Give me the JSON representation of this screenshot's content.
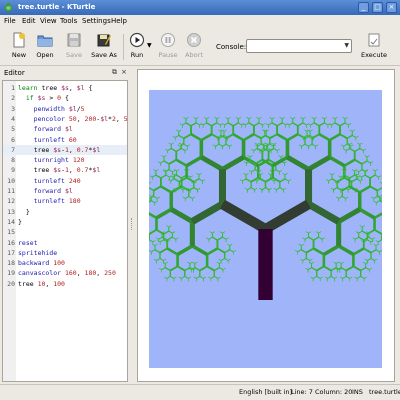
{
  "window": {
    "title": "tree.turtle - KTurtle",
    "buttons": {
      "minimize": "_",
      "maximize": "□",
      "close": "×"
    }
  },
  "menu": [
    "File",
    "Edit",
    "View",
    "Tools",
    "Settings",
    "Help"
  ],
  "toolbar": {
    "new_label": "New",
    "open_label": "Open",
    "save_label": "Save",
    "save_as_label": "Save As",
    "run_label": "Run",
    "pause_label": "Pause",
    "abort_label": "Abort",
    "console_label": "Console:",
    "console_value": "",
    "execute_label": "Execute"
  },
  "editor": {
    "title": "Editor",
    "current_line": 7,
    "lines": [
      {
        "n": "1",
        "segs": [
          [
            "kw",
            "learn"
          ],
          [
            "plain",
            " tree "
          ],
          [
            "var",
            "$s"
          ],
          [
            "plain",
            ", "
          ],
          [
            "var",
            "$l"
          ],
          [
            "plain",
            " {"
          ]
        ]
      },
      {
        "n": "2",
        "segs": [
          [
            "plain",
            "  "
          ],
          [
            "kw",
            "if"
          ],
          [
            "plain",
            " "
          ],
          [
            "var",
            "$s"
          ],
          [
            "plain",
            " > "
          ],
          [
            "num",
            "0"
          ],
          [
            "plain",
            " {"
          ]
        ]
      },
      {
        "n": "3",
        "segs": [
          [
            "plain",
            "    "
          ],
          [
            "cmd",
            "penwidth"
          ],
          [
            "plain",
            " "
          ],
          [
            "var",
            "$l"
          ],
          [
            "plain",
            "/"
          ],
          [
            "num",
            "5"
          ]
        ]
      },
      {
        "n": "4",
        "segs": [
          [
            "plain",
            "    "
          ],
          [
            "cmd",
            "pencolor"
          ],
          [
            "plain",
            " "
          ],
          [
            "num",
            "50"
          ],
          [
            "plain",
            ", "
          ],
          [
            "num",
            "200"
          ],
          [
            "plain",
            "-"
          ],
          [
            "var",
            "$l"
          ],
          [
            "plain",
            "*"
          ],
          [
            "num",
            "2"
          ],
          [
            "plain",
            ", "
          ],
          [
            "num",
            "50"
          ]
        ]
      },
      {
        "n": "5",
        "segs": [
          [
            "plain",
            "    "
          ],
          [
            "cmd",
            "forward"
          ],
          [
            "plain",
            " "
          ],
          [
            "var",
            "$l"
          ]
        ]
      },
      {
        "n": "6",
        "segs": [
          [
            "plain",
            "    "
          ],
          [
            "cmd",
            "turnleft"
          ],
          [
            "plain",
            " "
          ],
          [
            "num",
            "60"
          ]
        ]
      },
      {
        "n": "7",
        "segs": [
          [
            "plain",
            "    "
          ],
          [
            "plain",
            "tree "
          ],
          [
            "var",
            "$s"
          ],
          [
            "plain",
            "-"
          ],
          [
            "num",
            "1"
          ],
          [
            "plain",
            ", "
          ],
          [
            "num",
            "0.7"
          ],
          [
            "plain",
            "*"
          ],
          [
            "var",
            "$l"
          ]
        ]
      },
      {
        "n": "8",
        "segs": [
          [
            "plain",
            "    "
          ],
          [
            "cmd",
            "turnright"
          ],
          [
            "plain",
            " "
          ],
          [
            "num",
            "120"
          ]
        ]
      },
      {
        "n": "9",
        "segs": [
          [
            "plain",
            "    "
          ],
          [
            "plain",
            "tree "
          ],
          [
            "var",
            "$s"
          ],
          [
            "plain",
            "-"
          ],
          [
            "num",
            "1"
          ],
          [
            "plain",
            ", "
          ],
          [
            "num",
            "0.7"
          ],
          [
            "plain",
            "*"
          ],
          [
            "var",
            "$l"
          ]
        ]
      },
      {
        "n": "10",
        "segs": [
          [
            "plain",
            "    "
          ],
          [
            "cmd",
            "turnleft"
          ],
          [
            "plain",
            " "
          ],
          [
            "num",
            "240"
          ]
        ]
      },
      {
        "n": "11",
        "segs": [
          [
            "plain",
            "    "
          ],
          [
            "cmd",
            "forward"
          ],
          [
            "plain",
            " "
          ],
          [
            "var",
            "$l"
          ]
        ]
      },
      {
        "n": "12",
        "segs": [
          [
            "plain",
            "    "
          ],
          [
            "cmd",
            "turnleft"
          ],
          [
            "plain",
            " "
          ],
          [
            "num",
            "180"
          ]
        ]
      },
      {
        "n": "13",
        "segs": [
          [
            "plain",
            "  }"
          ]
        ]
      },
      {
        "n": "14",
        "segs": [
          [
            "plain",
            "}"
          ]
        ]
      },
      {
        "n": "15",
        "segs": []
      },
      {
        "n": "16",
        "segs": [
          [
            "cmd",
            "reset"
          ]
        ]
      },
      {
        "n": "17",
        "segs": [
          [
            "cmd",
            "spritehide"
          ]
        ]
      },
      {
        "n": "18",
        "segs": [
          [
            "cmd",
            "backward"
          ],
          [
            "plain",
            " "
          ],
          [
            "num",
            "100"
          ]
        ]
      },
      {
        "n": "19",
        "segs": [
          [
            "cmd",
            "canvascolor"
          ],
          [
            "plain",
            " "
          ],
          [
            "num",
            "160"
          ],
          [
            "plain",
            ", "
          ],
          [
            "num",
            "180"
          ],
          [
            "plain",
            ", "
          ],
          [
            "num",
            "250"
          ]
        ]
      },
      {
        "n": "20",
        "segs": [
          [
            "plain",
            "tree "
          ],
          [
            "num",
            "10"
          ],
          [
            "plain",
            ", "
          ],
          [
            "num",
            "100"
          ]
        ]
      }
    ]
  },
  "canvas": {
    "background": "#a0b4fa",
    "program": {
      "depth": 10,
      "length": 100,
      "backward": 100
    }
  },
  "status": {
    "language": "English [built in]",
    "position": "Line: 7 Column: 20",
    "mode": "INS",
    "file": "tree.turtle"
  },
  "colors": {
    "titlebar": "#3f74c4",
    "keyword": "#008000",
    "command": "#1a1ab0",
    "number": "#b02020",
    "variable": "#8b2252"
  }
}
